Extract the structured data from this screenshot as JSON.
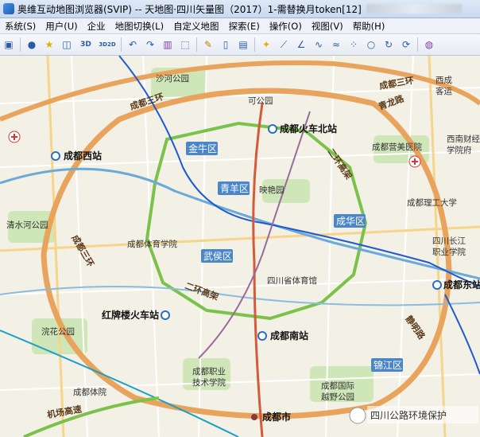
{
  "window": {
    "title": "奥维互动地图浏览器(SVIP) -- 天地图·四川矢量图（2017）1-需替换月token[12]"
  },
  "menu": [
    "系统(S)",
    "用户(U)",
    "企业",
    "地图切换(L)",
    "自定义地图",
    "探索(E)",
    "操作(O)",
    "视图(V)",
    "帮助(H)"
  ],
  "toolbar": {
    "btn_3d": "3D",
    "btn_3d2d": "3D2D"
  },
  "map": {
    "districts": {
      "jinniu": "金牛区",
      "qingyang": "青羊区",
      "chenghua": "成华区",
      "wuhou": "武侯区",
      "jinjiang": "锦江区"
    },
    "stations": {
      "north": "成都火车北站",
      "west": "成都西站",
      "east": "成都东站",
      "south": "成都南站",
      "hongpailou": "红牌楼火车站"
    },
    "roads": {
      "ring3_north": "成都三环",
      "ring3_ne": "成都三环",
      "ring3_west": "成都三环",
      "ring2_ne": "二环高架",
      "ring2_sw": "二环高架",
      "airport_expwy": "机场高速",
      "qinglong": "青龙路",
      "jingming": "静明路"
    },
    "places": {
      "shaoshi": "沙河公园",
      "kehe": "可公园",
      "yingyang": "映艳园",
      "xihe": "西成",
      "keyun": "客运",
      "xinan": "西南财经",
      "xuefu": "学院府",
      "chengdu_yingmei": "成都营美医院",
      "chengdu_ligong": "成都理工大学",
      "sichuan_changjiang": "四川长江",
      "zhiye": "职业学院",
      "qingshui": "清水河公园",
      "tiyu": "成都体育学院",
      "shengtiyu": "四川省体育馆",
      "huanhua": "浣花公园",
      "zhiye_jishu1": "成都职业",
      "zhiye_jishu2": "技术学院",
      "tiyuyuan": "成都体院",
      "guoji1": "成都国际",
      "guoji2": "越野公园",
      "city": "成都市"
    },
    "watermark": "四川公路环境保护"
  }
}
